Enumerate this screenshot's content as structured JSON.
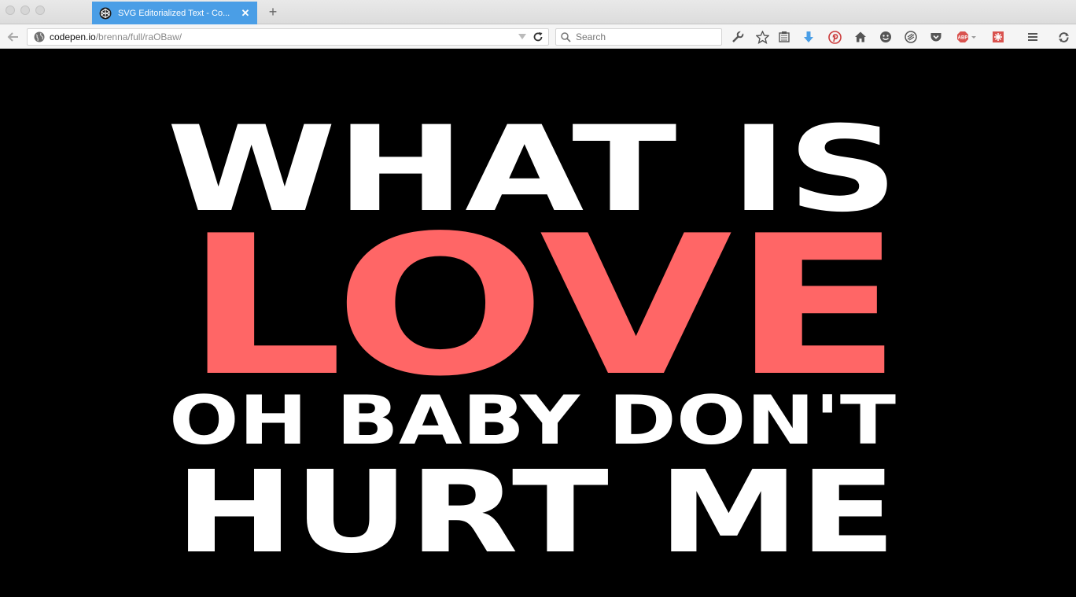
{
  "browser": {
    "tab": {
      "title": "SVG Editorialized Text - Co...",
      "favicon": "codepen-icon"
    },
    "new_tab_label": "+",
    "close_label": "✕",
    "url": {
      "host": "codepen.io",
      "path": "/brenna/full/raOBaw/"
    },
    "search": {
      "placeholder": "Search"
    },
    "toolbar_icons": [
      "wrench-icon",
      "star-icon",
      "reading-list-icon",
      "download-icon",
      "pinterest-icon",
      "home-icon",
      "smiley-icon",
      "sync-icon",
      "pocket-icon",
      "adblock-icon",
      "extension-icon",
      "menu-icon",
      "refresh-extension-icon"
    ],
    "adblock_label": "ABP"
  },
  "poster": {
    "line1": "WHAT IS",
    "line2": "LOVE",
    "line3": "OH BABY DON'T",
    "line4": "HURT ME",
    "colors": {
      "text": "#ffffff",
      "accent": "#ff6666",
      "background": "#000000"
    }
  }
}
